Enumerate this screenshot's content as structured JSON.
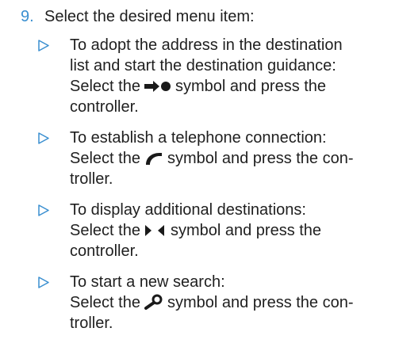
{
  "step": {
    "number": "9.",
    "text": "Select the desired menu item:"
  },
  "items": [
    {
      "lines": [
        "To adopt the address in the destination",
        "list and start the destination guidance:"
      ],
      "select_prefix": "Select the",
      "symbol": "arrow-dot-icon",
      "after_lines": [
        "symbol and press the",
        "controller."
      ]
    },
    {
      "lines": [
        "To establish a telephone connection:"
      ],
      "select_prefix": "Select the",
      "symbol": "telephone-icon",
      "after_lines": [
        "symbol and press the con-",
        "troller."
      ]
    },
    {
      "lines": [
        "To display additional destinations:"
      ],
      "select_prefix": "Select the",
      "symbol": "next-prev-arrows-icon",
      "after_lines": [
        "symbol and press the",
        "controller."
      ]
    },
    {
      "lines": [
        "To start a new search:"
      ],
      "select_prefix": "Select the",
      "symbol": "search-icon",
      "after_lines": [
        "symbol and press the con-",
        "troller."
      ]
    }
  ],
  "colors": {
    "accent": "#3a8fd0",
    "text": "#1f1f1f"
  }
}
